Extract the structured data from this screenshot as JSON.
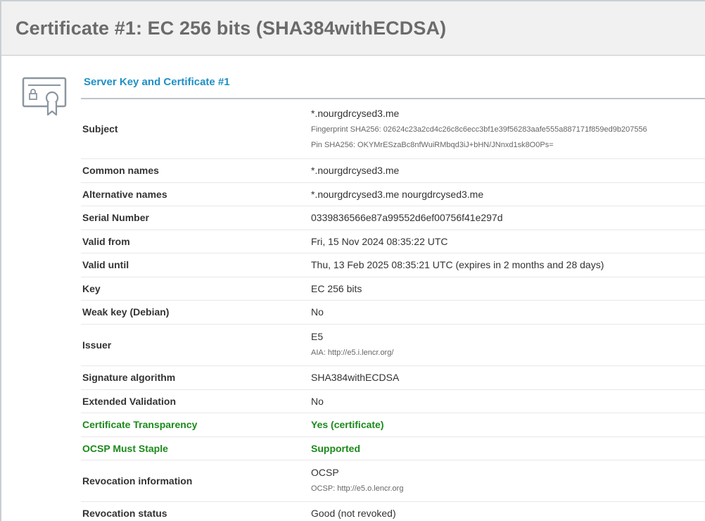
{
  "page": {
    "title": "Certificate #1: EC 256 bits (SHA384withECDSA)"
  },
  "section": {
    "heading": "Server Key and Certificate #1"
  },
  "rows": {
    "subject": {
      "label": "Subject",
      "value": "*.nourgdrcysed3.me",
      "fingerprint": "Fingerprint SHA256: 02624c23a2cd4c26c8c6ecc3bf1e39f56283aafe555a887171f859ed9b207556",
      "pin": "Pin SHA256: OKYMrESzaBc8nfWuiRMbqd3iJ+bHN/JNnxd1sk8O0Ps="
    },
    "common_names": {
      "label": "Common names",
      "value": "*.nourgdrcysed3.me"
    },
    "alternative_names": {
      "label": "Alternative names",
      "value": "*.nourgdrcysed3.me nourgdrcysed3.me"
    },
    "serial_number": {
      "label": "Serial Number",
      "value": "0339836566e87a99552d6ef00756f41e297d"
    },
    "valid_from": {
      "label": "Valid from",
      "value": "Fri, 15 Nov 2024 08:35:22 UTC"
    },
    "valid_until": {
      "label": "Valid until",
      "value": "Thu, 13 Feb 2025 08:35:21 UTC (expires in 2 months and 28 days)"
    },
    "key": {
      "label": "Key",
      "value": "EC 256 bits"
    },
    "weak_key": {
      "label": "Weak key (Debian)",
      "value": "No"
    },
    "issuer": {
      "label": "Issuer",
      "value": "E5",
      "aia": "AIA: http://e5.i.lencr.org/"
    },
    "signature_algorithm": {
      "label": "Signature algorithm",
      "value": "SHA384withECDSA"
    },
    "extended_validation": {
      "label": "Extended Validation",
      "value": "No"
    },
    "certificate_transparency": {
      "label": "Certificate Transparency",
      "value": "Yes (certificate)"
    },
    "ocsp_must_staple": {
      "label": "OCSP Must Staple",
      "value": "Supported"
    },
    "revocation_information": {
      "label": "Revocation information",
      "value": "OCSP",
      "ocsp": "OCSP: http://e5.o.lencr.org"
    },
    "revocation_status": {
      "label": "Revocation status",
      "value": "Good (not revoked)"
    }
  },
  "colors": {
    "heading": "#1e8fc6",
    "positive": "#1a8a1a",
    "title": "#6b6b6b"
  },
  "icons": {
    "certificate": "certificate-icon"
  }
}
